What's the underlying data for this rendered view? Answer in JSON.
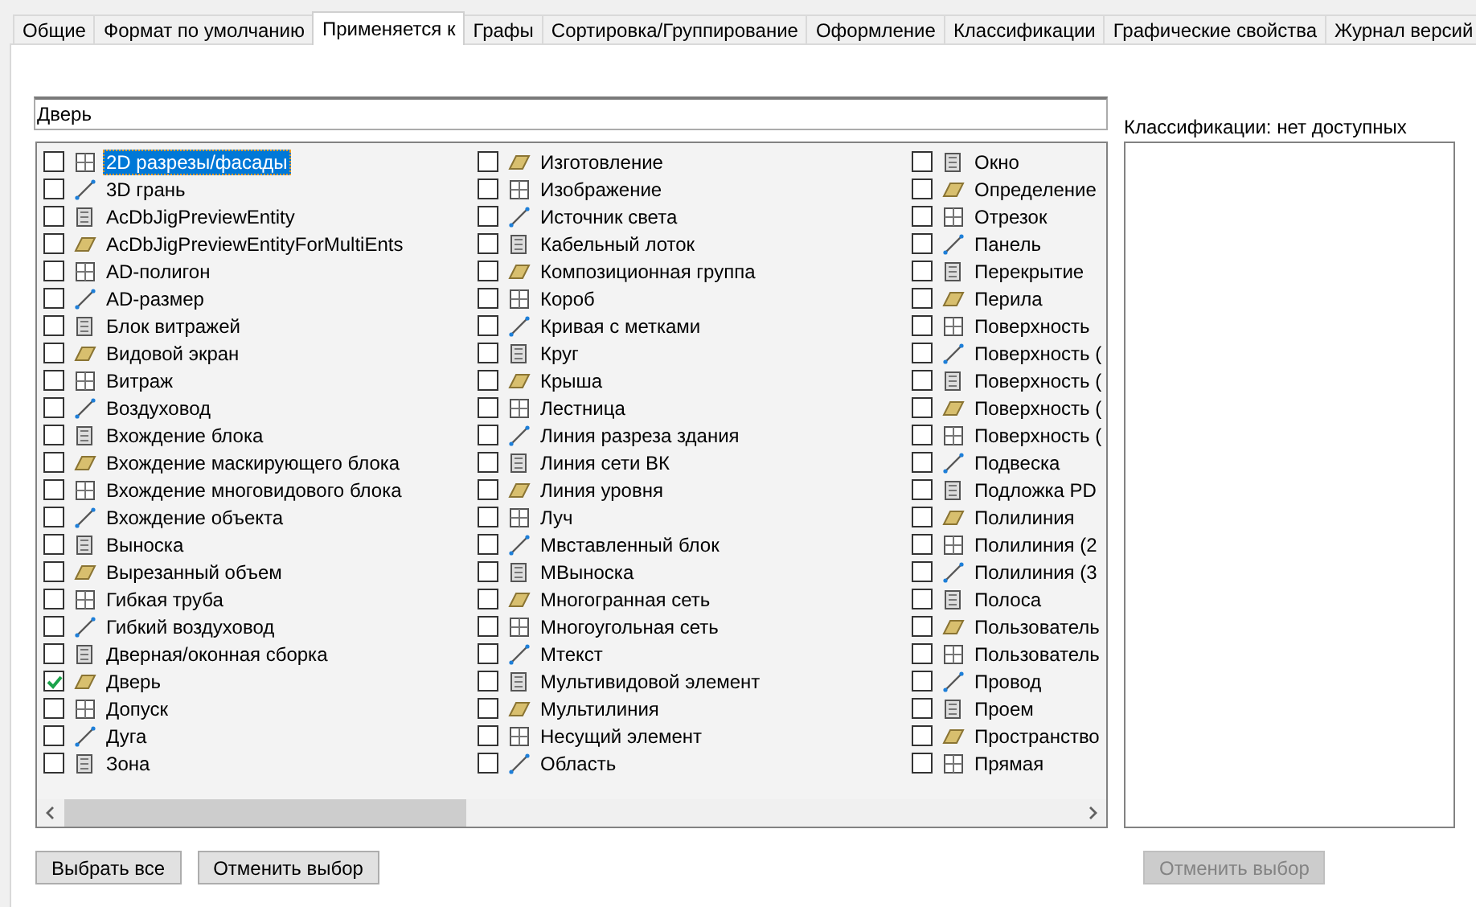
{
  "tabs": [
    {
      "label": "Общие",
      "selected": false
    },
    {
      "label": "Формат по умолчанию",
      "selected": false
    },
    {
      "label": "Применяется к",
      "selected": true
    },
    {
      "label": "Графы",
      "selected": false
    },
    {
      "label": "Сортировка/Группирование",
      "selected": false
    },
    {
      "label": "Оформление",
      "selected": false
    },
    {
      "label": "Классификации",
      "selected": false
    },
    {
      "label": "Графические свойства",
      "selected": false
    },
    {
      "label": "Журнал версий",
      "selected": false
    }
  ],
  "name_field": {
    "value": "Дверь"
  },
  "object_list": {
    "columns": [
      {
        "items": [
          {
            "label": "2D разрезы/фасады",
            "checked": false,
            "selected": true
          },
          {
            "label": "3D грань",
            "checked": false,
            "selected": false
          },
          {
            "label": "AcDbJigPreviewEntity",
            "checked": false,
            "selected": false
          },
          {
            "label": "AcDbJigPreviewEntityForMultiEnts",
            "checked": false,
            "selected": false
          },
          {
            "label": "AD-полигон",
            "checked": false,
            "selected": false
          },
          {
            "label": "AD-размер",
            "checked": false,
            "selected": false
          },
          {
            "label": "Блок витражей",
            "checked": false,
            "selected": false
          },
          {
            "label": "Видовой экран",
            "checked": false,
            "selected": false
          },
          {
            "label": "Витраж",
            "checked": false,
            "selected": false
          },
          {
            "label": "Воздуховод",
            "checked": false,
            "selected": false
          },
          {
            "label": "Вхождение блока",
            "checked": false,
            "selected": false
          },
          {
            "label": "Вхождение маскирующего блока",
            "checked": false,
            "selected": false
          },
          {
            "label": "Вхождение многовидового блока",
            "checked": false,
            "selected": false
          },
          {
            "label": "Вхождение объекта",
            "checked": false,
            "selected": false
          },
          {
            "label": "Выноска",
            "checked": false,
            "selected": false
          },
          {
            "label": "Вырезанный объем",
            "checked": false,
            "selected": false
          },
          {
            "label": "Гибкая труба",
            "checked": false,
            "selected": false
          },
          {
            "label": "Гибкий воздуховод",
            "checked": false,
            "selected": false
          },
          {
            "label": "Дверная/оконная сборка",
            "checked": false,
            "selected": false
          },
          {
            "label": "Дверь",
            "checked": true,
            "selected": false
          },
          {
            "label": "Допуск",
            "checked": false,
            "selected": false
          },
          {
            "label": "Дуга",
            "checked": false,
            "selected": false
          },
          {
            "label": "Зона",
            "checked": false,
            "selected": false
          }
        ]
      },
      {
        "items": [
          {
            "label": "Изготовление",
            "checked": false,
            "selected": false
          },
          {
            "label": "Изображение",
            "checked": false,
            "selected": false
          },
          {
            "label": "Источник света",
            "checked": false,
            "selected": false
          },
          {
            "label": "Кабельный лоток",
            "checked": false,
            "selected": false
          },
          {
            "label": "Композиционная группа",
            "checked": false,
            "selected": false
          },
          {
            "label": "Короб",
            "checked": false,
            "selected": false
          },
          {
            "label": "Кривая с метками",
            "checked": false,
            "selected": false
          },
          {
            "label": "Круг",
            "checked": false,
            "selected": false
          },
          {
            "label": "Крыша",
            "checked": false,
            "selected": false
          },
          {
            "label": "Лестница",
            "checked": false,
            "selected": false
          },
          {
            "label": "Линия разреза здания",
            "checked": false,
            "selected": false
          },
          {
            "label": "Линия сети ВК",
            "checked": false,
            "selected": false
          },
          {
            "label": "Линия уровня",
            "checked": false,
            "selected": false
          },
          {
            "label": "Луч",
            "checked": false,
            "selected": false
          },
          {
            "label": "Мвставленный блок",
            "checked": false,
            "selected": false
          },
          {
            "label": "МВыноска",
            "checked": false,
            "selected": false
          },
          {
            "label": "Многогранная сеть",
            "checked": false,
            "selected": false
          },
          {
            "label": "Многоугольная сеть",
            "checked": false,
            "selected": false
          },
          {
            "label": "Мтекст",
            "checked": false,
            "selected": false
          },
          {
            "label": "Мультивидовой элемент",
            "checked": false,
            "selected": false
          },
          {
            "label": "Мультилиния",
            "checked": false,
            "selected": false
          },
          {
            "label": "Несущий элемент",
            "checked": false,
            "selected": false
          },
          {
            "label": "Область",
            "checked": false,
            "selected": false
          }
        ]
      },
      {
        "items": [
          {
            "label": "Окно",
            "checked": false,
            "selected": false
          },
          {
            "label": "Определение",
            "checked": false,
            "selected": false
          },
          {
            "label": "Отрезок",
            "checked": false,
            "selected": false
          },
          {
            "label": "Панель",
            "checked": false,
            "selected": false
          },
          {
            "label": "Перекрытие",
            "checked": false,
            "selected": false
          },
          {
            "label": "Перила",
            "checked": false,
            "selected": false
          },
          {
            "label": "Поверхность",
            "checked": false,
            "selected": false
          },
          {
            "label": "Поверхность (",
            "checked": false,
            "selected": false
          },
          {
            "label": "Поверхность (",
            "checked": false,
            "selected": false
          },
          {
            "label": "Поверхность (",
            "checked": false,
            "selected": false
          },
          {
            "label": "Поверхность (",
            "checked": false,
            "selected": false
          },
          {
            "label": "Подвеска",
            "checked": false,
            "selected": false
          },
          {
            "label": "Подложка PD",
            "checked": false,
            "selected": false
          },
          {
            "label": "Полилиния",
            "checked": false,
            "selected": false
          },
          {
            "label": "Полилиния (2",
            "checked": false,
            "selected": false
          },
          {
            "label": "Полилиния (3",
            "checked": false,
            "selected": false
          },
          {
            "label": "Полоса",
            "checked": false,
            "selected": false
          },
          {
            "label": "Пользователь",
            "checked": false,
            "selected": false
          },
          {
            "label": "Пользователь",
            "checked": false,
            "selected": false
          },
          {
            "label": "Провод",
            "checked": false,
            "selected": false
          },
          {
            "label": "Проем",
            "checked": false,
            "selected": false
          },
          {
            "label": "Пространство",
            "checked": false,
            "selected": false
          },
          {
            "label": "Прямая",
            "checked": false,
            "selected": false
          }
        ]
      }
    ]
  },
  "classifications": {
    "label": "Классификации: нет доступных"
  },
  "buttons": [
    {
      "label": "Выбрать все",
      "disabled": false
    },
    {
      "label": "Отменить выбор",
      "disabled": false
    }
  ],
  "classification_buttons": [
    {
      "label": "Отменить выбор",
      "disabled": true
    }
  ]
}
